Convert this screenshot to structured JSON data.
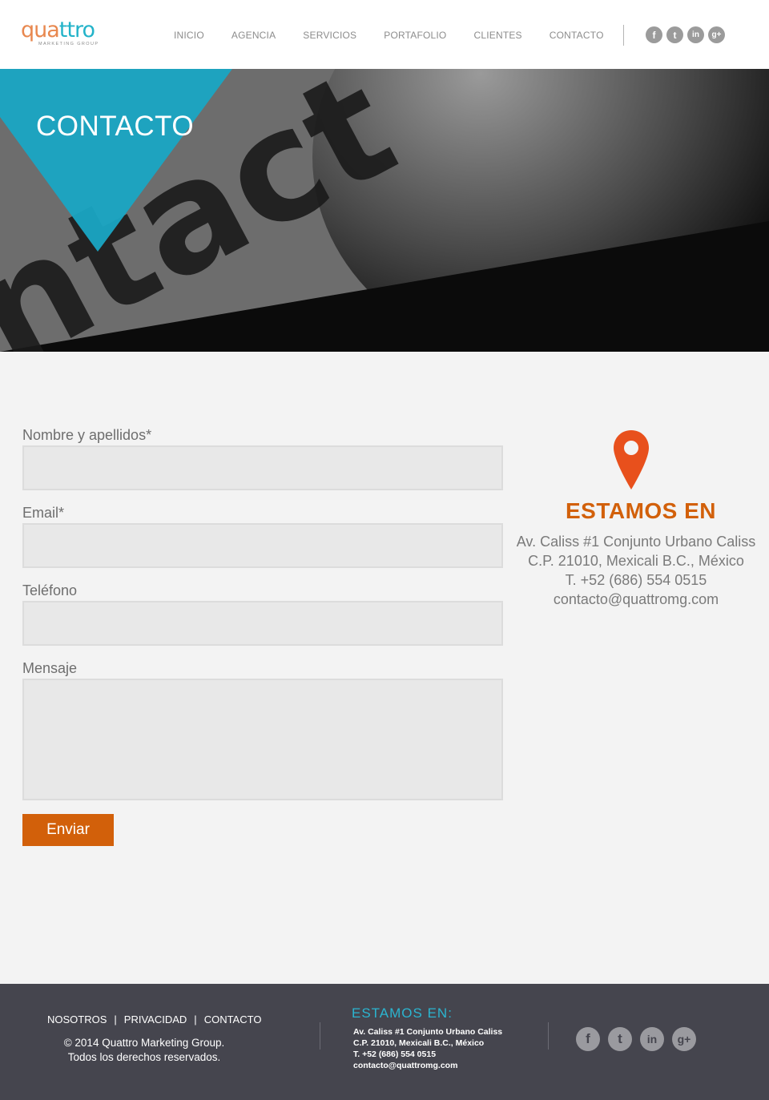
{
  "header": {
    "logo": {
      "part1": "qua",
      "part2": "ttro",
      "tagline": "MARKETING GROUP"
    },
    "nav": [
      "INICIO",
      "AGENCIA",
      "SERVICIOS",
      "PORTAFOLIO",
      "CLIENTES",
      "CONTACTO"
    ],
    "social": [
      {
        "icon": "facebook-icon",
        "glyph": "f"
      },
      {
        "icon": "twitter-icon",
        "glyph": "t"
      },
      {
        "icon": "linkedin-icon",
        "glyph": "in"
      },
      {
        "icon": "googleplus-icon",
        "glyph": "g+"
      }
    ]
  },
  "hero": {
    "title": "CONTACTO",
    "triangle_color": "#1aa6c4"
  },
  "form": {
    "name_label": "Nombre y apellidos*",
    "email_label": "Email*",
    "phone_label": "Teléfono",
    "message_label": "Mensaje",
    "name_value": "",
    "email_value": "",
    "phone_value": "",
    "message_value": "",
    "submit_label": "Enviar"
  },
  "contact_info": {
    "heading": "ESTAMOS EN",
    "address_line1": "Av. Caliss #1 Conjunto Urbano Caliss",
    "address_line2": "C.P. 21010, Mexicali B.C., México",
    "phone": "T. +52 (686) 554 0515",
    "email": "contacto@quattromg.com",
    "accent_color": "#d2600a",
    "pin_color": "#e8501c"
  },
  "footer": {
    "links": [
      "NOSOTROS",
      "PRIVACIDAD",
      "CONTACTO"
    ],
    "separator": "|",
    "copyright_line1": "© 2014 Quattro Marketing Group.",
    "copyright_line2": "Todos los derechos reservados.",
    "heading": "ESTAMOS EN:",
    "address_line1": "Av. Caliss #1 Conjunto Urbano Caliss",
    "address_line2": "C.P. 21010, Mexicali B.C., México",
    "phone": "T. +52 (686) 554 0515",
    "email": "contacto@quattromg.com",
    "social": [
      {
        "icon": "facebook-icon",
        "glyph": "f"
      },
      {
        "icon": "twitter-icon",
        "glyph": "t"
      },
      {
        "icon": "linkedin-icon",
        "glyph": "in"
      },
      {
        "icon": "googleplus-icon",
        "glyph": "g+"
      }
    ]
  }
}
